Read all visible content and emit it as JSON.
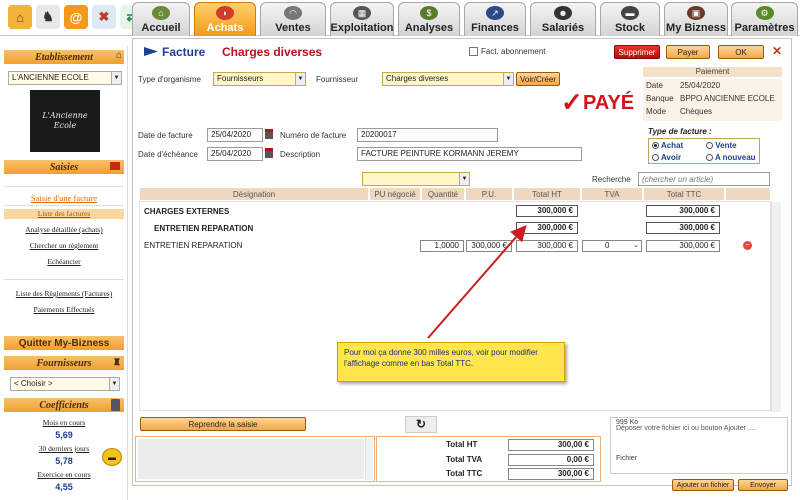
{
  "nav": {
    "tabs": [
      "Accueil",
      "Achats",
      "Ventes",
      "Exploitation",
      "Analyses",
      "Finances",
      "Salariés",
      "Stock",
      "My Bizness",
      "Paramètres"
    ]
  },
  "sidebar": {
    "etablissement_title": "Etablissement",
    "etablissement_value": "L'ANCIENNE ECOLE",
    "logo_text": "L'Ancienne Ecole",
    "saisies_title": "Saisies",
    "links": [
      "Saisie d'une facture",
      "Liste des factures",
      "Analyse détaillée (achats)",
      "Chercher un règlement",
      "Echéancier"
    ],
    "links2": [
      "Liste des Règlements (Factures)",
      "Paiements Effectués"
    ],
    "quitter": "Quitter My-Bizness",
    "fournisseurs_title": "Fournisseurs",
    "fournisseurs_value": "< Choisir >",
    "coefficients_title": "Coefficients",
    "coefs": [
      {
        "label": "Mois en cours",
        "value": "5,69"
      },
      {
        "label": "30 derniers jours",
        "value": "5,78"
      },
      {
        "label": "Exercice en cours",
        "value": "4,55"
      }
    ]
  },
  "header": {
    "title": "Facture",
    "subtitle": "Charges diverses",
    "abonnement": "Fact. abonnement",
    "btn_supprimer": "Supprimer",
    "btn_payer": "Payer",
    "btn_ok": "OK",
    "close": "✕"
  },
  "form": {
    "type_org_label": "Type d'organisme",
    "type_org_value": "Fournisseurs",
    "fournisseur_label": "Fournisseur",
    "fournisseur_value": "Charges diverses",
    "voir_creer": "Voir/Créer",
    "date_facture_label": "Date de facture",
    "date_facture": "25/04/2020",
    "numero_label": "Numéro de facture",
    "numero": "20200017",
    "date_echeance_label": "Date d'échéance",
    "date_echeance": "25/04/2020",
    "description_label": "Description",
    "description": "FACTURE PEINTURE KORMANN JEREMY",
    "paye": "PAYÉ",
    "recherche_label": "Recherche",
    "recherche_placeholder": "(chercher un article)"
  },
  "paiement": {
    "title": "Paiement",
    "rows": [
      {
        "label": "Date",
        "value": "25/04/2020"
      },
      {
        "label": "Banque",
        "value": "BPPO ANCIENNE ECOLE"
      },
      {
        "label": "Mode",
        "value": "Chèques"
      }
    ]
  },
  "type_facture": {
    "title": "Type de facture :",
    "options": [
      "Achat",
      "Vente",
      "Avoir",
      "A nouveau"
    ]
  },
  "grid": {
    "headers": [
      "Désignation",
      "PU négocié",
      "Quantité",
      "P.U.",
      "Total HT",
      "TVA",
      "Total TTC"
    ],
    "rows": [
      {
        "designation": "CHARGES EXTERNES",
        "total_ht": "300,000 €",
        "total_ttc": "300,000 €"
      },
      {
        "designation": "ENTRETIEN REPARATION",
        "total_ht": "300,000 €",
        "total_ttc": "300,000 €"
      },
      {
        "designation": "ENTRETIEN REPARATION",
        "quantite": "1,0000",
        "pu": "300,000 €",
        "total_ht": "300,000 €",
        "tva": "0",
        "total_ttc": "300,000 €"
      }
    ]
  },
  "callout": {
    "text": "Pour moi ça donne 300 milles euros, voir pour modifier l'affichage comme en bas Total TTC."
  },
  "footer": {
    "reprendre": "Reprendre la saisie",
    "refresh_icon": "↻",
    "totals": [
      {
        "label": "Total HT",
        "value": "300,00 €"
      },
      {
        "label": "Total TVA",
        "value": "0,00 €"
      },
      {
        "label": "Total TTC",
        "value": "300,00 €"
      }
    ],
    "file_size": "999 Ko",
    "drop_text": "Déposer votre fichier ici ou bouton Ajouter ....",
    "fichier_label": "Fichier",
    "ajouter": "Ajouter un fichier",
    "envoyer": "Envoyer"
  }
}
